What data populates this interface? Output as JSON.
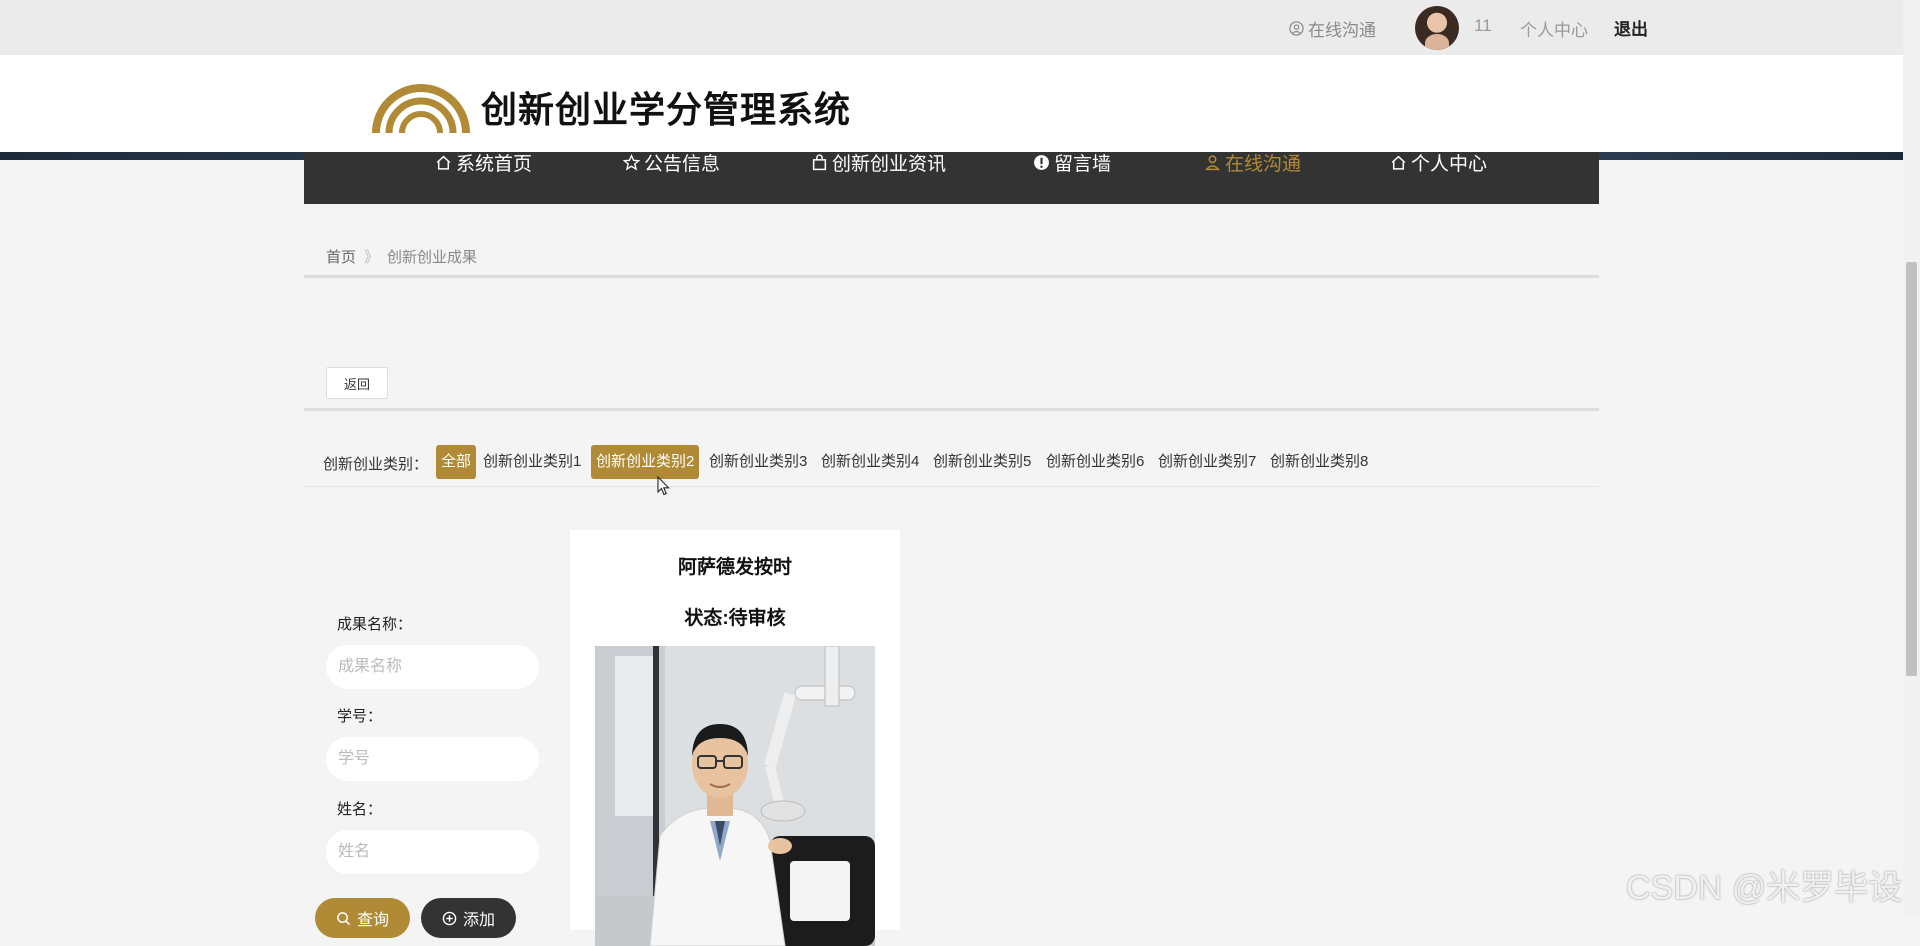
{
  "topbar": {
    "chat_label": "在线沟通",
    "user_id": "11",
    "center_label": "个人中心",
    "logout_label": "退出"
  },
  "header": {
    "title": "创新创业学分管理系统"
  },
  "nav": {
    "items": [
      {
        "label": "系统首页",
        "icon": "home-icon"
      },
      {
        "label": "公告信息",
        "icon": "star-icon"
      },
      {
        "label": "创新创业资讯",
        "icon": "bag-icon"
      },
      {
        "label": "留言墙",
        "icon": "alert-icon"
      },
      {
        "label": "在线沟通",
        "icon": "user-icon",
        "active": true
      },
      {
        "label": "个人中心",
        "icon": "home-icon"
      }
    ]
  },
  "breadcrumb": {
    "home": "首页",
    "separator": "》",
    "current": "创新创业成果"
  },
  "back_label": "返回",
  "categories": {
    "label": "创新创业类别：",
    "items": [
      "全部",
      "创新创业类别1",
      "创新创业类别2",
      "创新创业类别3",
      "创新创业类别4",
      "创新创业类别5",
      "创新创业类别6",
      "创新创业类别7",
      "创新创业类别8"
    ],
    "selected": [
      "全部",
      "创新创业类别2"
    ]
  },
  "search": {
    "name_label": "成果名称：",
    "name_placeholder": "成果名称",
    "id_label": "学号：",
    "id_placeholder": "学号",
    "student_label": "姓名：",
    "student_placeholder": "姓名",
    "search_button": "查询",
    "add_button": "添加"
  },
  "card": {
    "name": "阿萨德发按时",
    "status": "状态:待审核"
  },
  "watermark": "CSDN @米罗毕设",
  "colors": {
    "accent": "#b08a34",
    "nav_bg": "#333333"
  }
}
